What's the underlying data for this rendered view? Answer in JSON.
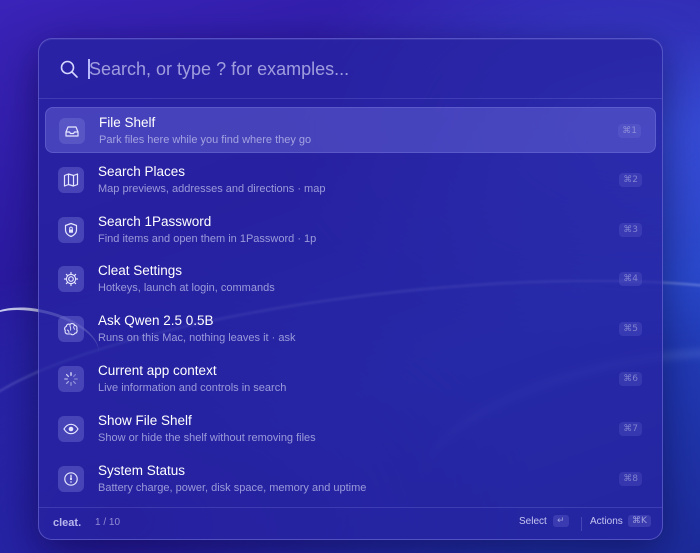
{
  "search": {
    "placeholder": "Search, or type ? for examples..."
  },
  "items": [
    {
      "title": "File Shelf",
      "subtitle": "Park files here while you find where they go",
      "shortcut": "⌘1",
      "icon": "tray-icon",
      "selected": true
    },
    {
      "title": "Search Places",
      "subtitle": "Map previews, addresses and directions · map",
      "shortcut": "⌘2",
      "icon": "map-icon"
    },
    {
      "title": "Search 1Password",
      "subtitle": "Find items and open them in 1Password · 1p",
      "shortcut": "⌘3",
      "icon": "shield-lock-icon"
    },
    {
      "title": "Cleat Settings",
      "subtitle": "Hotkeys, launch at login, commands",
      "shortcut": "⌘4",
      "icon": "gear-icon"
    },
    {
      "title": "Ask Qwen 2.5 0.5B",
      "subtitle": "Runs on this Mac, nothing leaves it · ask",
      "shortcut": "⌘5",
      "icon": "brain-icon"
    },
    {
      "title": "Current app context",
      "subtitle": "Live information and controls in search",
      "shortcut": "⌘6",
      "icon": "loading-spinner-icon"
    },
    {
      "title": "Show File Shelf",
      "subtitle": "Show or hide the shelf without removing files",
      "shortcut": "⌘7",
      "icon": "eye-icon"
    },
    {
      "title": "System Status",
      "subtitle": "Battery charge, power, disk space, memory and uptime",
      "shortcut": "⌘8",
      "icon": "gauge-icon"
    }
  ],
  "footer": {
    "brand": "cleat.",
    "counter": "1 / 10",
    "select_label": "Select",
    "select_key": "↵",
    "actions_label": "Actions",
    "actions_key": "⌘K"
  },
  "colors": {
    "accent": "#2a1fa8",
    "selected_row": "#5c5acb"
  }
}
